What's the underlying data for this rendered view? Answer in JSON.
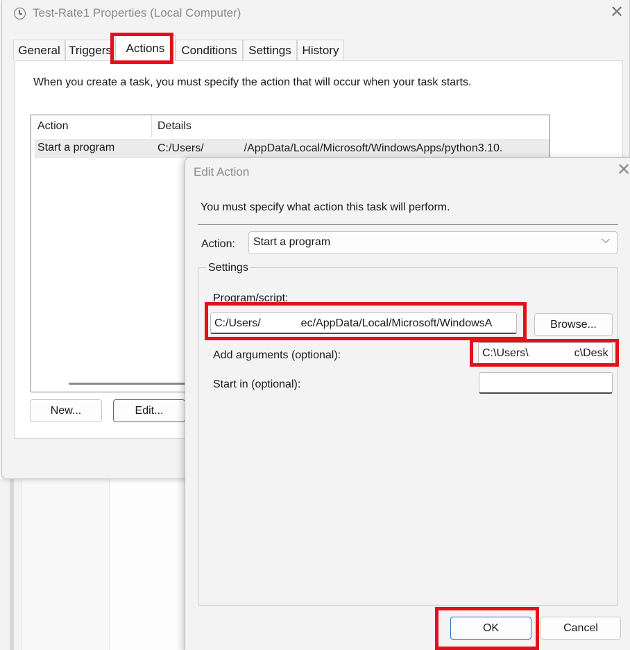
{
  "properties_window": {
    "title": "Test-Rate1 Properties (Local Computer)",
    "tabs": [
      "General",
      "Triggers",
      "Actions",
      "Conditions",
      "Settings",
      "History"
    ],
    "active_tab": "Actions",
    "intro_text": "When you create a task, you must specify the action that will occur when your task starts.",
    "list": {
      "columns": [
        "Action",
        "Details"
      ],
      "rows": [
        {
          "action": "Start a program",
          "details_prefix": "C:/Users/",
          "details_suffix": "/AppData/Local/Microsoft/WindowsApps/python3.10."
        }
      ]
    },
    "buttons": {
      "new": "New...",
      "edit": "Edit..."
    }
  },
  "edit_action_dialog": {
    "title": "Edit Action",
    "intro_text": "You must specify what action this task will perform.",
    "action_label": "Action:",
    "action_value": "Start a program",
    "settings_legend": "Settings",
    "program_label": "Program/script:",
    "program_value_prefix": "C:/Users/",
    "program_value_suffix": "ec/AppData/Local/Microsoft/WindowsA",
    "browse_label": "Browse...",
    "arguments_label": "Add arguments (optional):",
    "arguments_value_prefix": "C:\\Users\\",
    "arguments_value_suffix": "c\\Desk",
    "start_in_label": "Start in (optional):",
    "start_in_value": "",
    "ok_label": "OK",
    "cancel_label": "Cancel"
  },
  "colors": {
    "highlight_box": "#e3101c",
    "primary_button_border": "#2f6fc4",
    "window_bg": "#f3f3f3"
  },
  "icons": {
    "window_icon": "clock-icon",
    "close": "close-icon",
    "dropdown": "chevron-down-icon"
  }
}
